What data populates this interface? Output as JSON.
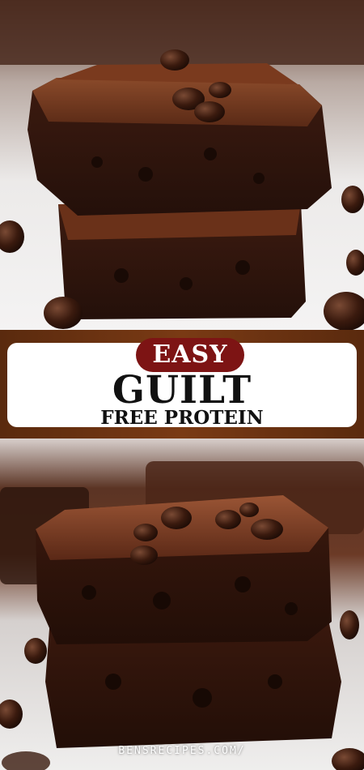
{
  "banner": {
    "badge": "EASY",
    "headline": "GUILT",
    "subline": "FREE PROTEIN"
  },
  "footer": {
    "website": "BENSRECIPES.COM/"
  },
  "colors": {
    "banner_background": "#6b3212",
    "badge_background": "#7d1414",
    "card_background": "#ffffff",
    "text": "#111111"
  },
  "images": {
    "top": "brownie-stack-photo",
    "bottom": "brownie-stack-photo"
  }
}
